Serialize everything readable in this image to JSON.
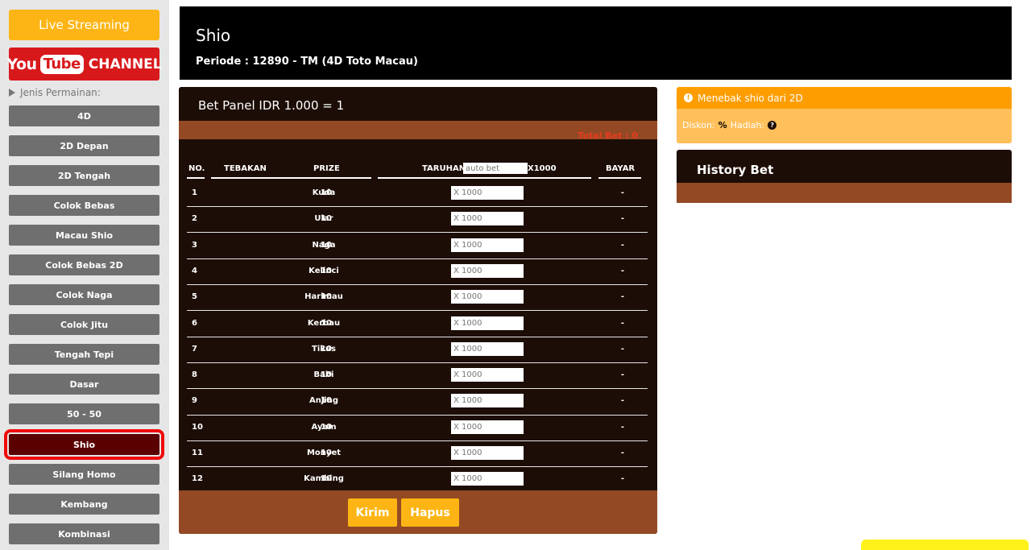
{
  "sidebar": {
    "live_label": "Live Streaming",
    "youtube": {
      "you": "You",
      "tube": "Tube",
      "channel": "CHANNEL"
    },
    "jenis_label": "Jenis Permainan:",
    "games": [
      "4D",
      "2D Depan",
      "2D Tengah",
      "Colok Bebas",
      "Macau Shio",
      "Colok Bebas 2D",
      "Colok Naga",
      "Colok Jitu",
      "Tengah Tepi",
      "Dasar",
      "50 - 50",
      "Shio",
      "Silang Homo",
      "Kembang",
      "Kombinasi"
    ],
    "active_game": "Shio"
  },
  "header": {
    "title": "Shio",
    "periode": "Periode : 12890 - TM (4D Toto Macau)"
  },
  "bet_panel": {
    "title": "Bet Panel IDR 1.000 = 1",
    "total_bet": "Total Bet : 0",
    "columns": {
      "no": "NO.",
      "tebakan": "TEBAKAN",
      "prize": "PRIZE",
      "taruhan": "TARUHAN",
      "x1000": "X1000",
      "bayar": "BAYAR"
    },
    "auto_bet_placeholder": "auto bet",
    "bet_placeholder": "X 1000",
    "rows": [
      {
        "no": "1",
        "tebakan": "Kuda",
        "prize": "10",
        "bayar": "-"
      },
      {
        "no": "2",
        "tebakan": "Ular",
        "prize": "10",
        "bayar": "-"
      },
      {
        "no": "3",
        "tebakan": "Naga",
        "prize": "10",
        "bayar": "-"
      },
      {
        "no": "4",
        "tebakan": "Kelinci",
        "prize": "10",
        "bayar": "-"
      },
      {
        "no": "5",
        "tebakan": "Harimau",
        "prize": "10",
        "bayar": "-"
      },
      {
        "no": "6",
        "tebakan": "Kerbau",
        "prize": "10",
        "bayar": "-"
      },
      {
        "no": "7",
        "tebakan": "Tikus",
        "prize": "10",
        "bayar": "-"
      },
      {
        "no": "8",
        "tebakan": "Babi",
        "prize": "10",
        "bayar": "-"
      },
      {
        "no": "9",
        "tebakan": "Anjing",
        "prize": "10",
        "bayar": "-"
      },
      {
        "no": "10",
        "tebakan": "Ayam",
        "prize": "10",
        "bayar": "-"
      },
      {
        "no": "11",
        "tebakan": "Monyet",
        "prize": "10",
        "bayar": "-"
      },
      {
        "no": "12",
        "tebakan": "Kambing",
        "prize": "10",
        "bayar": "-"
      }
    ],
    "kirim_label": "Kirim",
    "hapus_label": "Hapus"
  },
  "info": {
    "heading": "Menebak shio dari 2D",
    "diskon_label": "Diskon:",
    "diskon_value": "%",
    "hadiah_label": "Hadiah:"
  },
  "history": {
    "title": "History Bet"
  },
  "colors": {
    "accent": "#fdb515",
    "panel_dark": "#1c0d06",
    "panel_brown": "#934a24",
    "active_game": "#5b0000",
    "highlight": "#f00a0a"
  }
}
